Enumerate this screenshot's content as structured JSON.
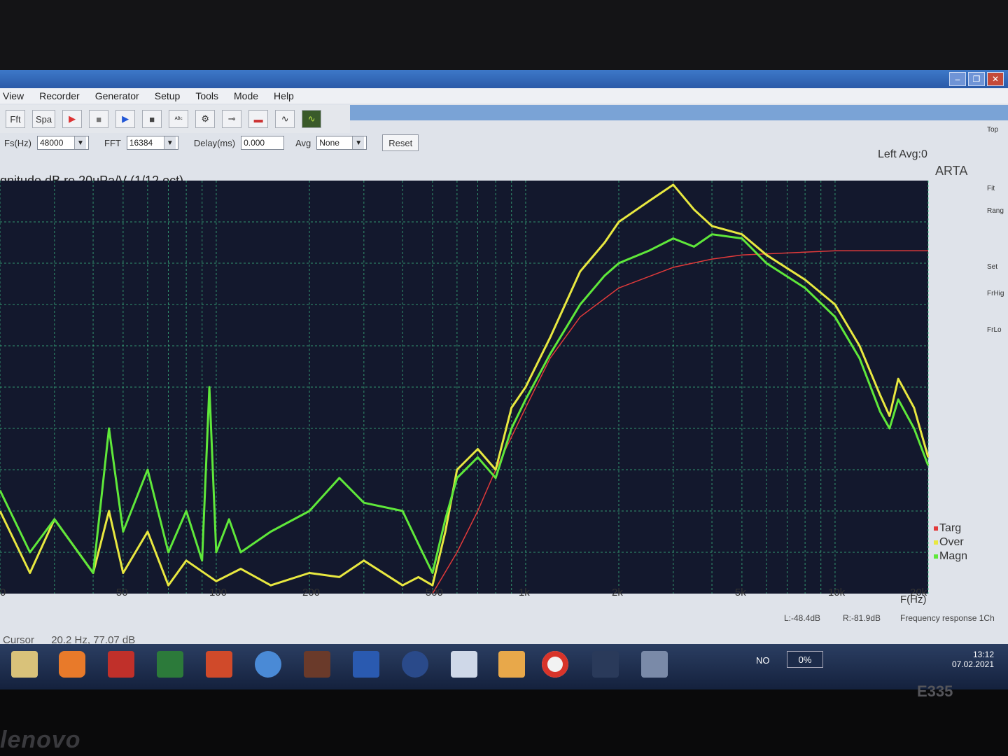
{
  "menu": [
    "View",
    "Recorder",
    "Generator",
    "Setup",
    "Tools",
    "Mode",
    "Help"
  ],
  "toolbar": {
    "fft_btn": "Fft",
    "spa_btn": "Spa",
    "fs_label": "Fs(Hz)",
    "fs_value": "48000",
    "fft_label": "FFT",
    "fft_value": "16384",
    "delay_label": "Delay(ms)",
    "delay_value": "0.000",
    "avg_label": "Avg",
    "avg_value": "None",
    "reset": "Reset"
  },
  "chart": {
    "title": "gnitude dB re 20uPa/V (1/12 oct)",
    "channel": "Left",
    "avg": "Avg:0",
    "arta": "ARTA",
    "xaxis_label": "F(Hz)",
    "status_left": "L:-48.4dB",
    "status_right": "R:-81.9dB",
    "status_mode": "Frequency response 1Ch",
    "cursor_label": "Cursor",
    "cursor_value": "20.2 Hz, 77.07 dB"
  },
  "chart_data": {
    "type": "line",
    "xscale": "log",
    "xlim": [
      20,
      20000
    ],
    "x_ticks": [
      20,
      50,
      100,
      200,
      500,
      1000,
      2000,
      5000,
      10000,
      20000
    ],
    "x_tick_labels": [
      "0",
      "50",
      "100",
      "200",
      "500",
      "1k",
      "2k",
      "5k",
      "10k",
      "20k"
    ],
    "xlabel": "F(Hz)",
    "ylabel": "gnitude dB re 20uPa/V (1/12 oct)",
    "grid": true,
    "legend": "right",
    "series": [
      {
        "name": "Targ",
        "color": "#e23a3a",
        "x": [
          500,
          600,
          700,
          800,
          1000,
          1200,
          1500,
          2000,
          3000,
          4000,
          5000,
          10000,
          20000
        ],
        "y": [
          0.0,
          0.1,
          0.2,
          0.3,
          0.45,
          0.57,
          0.67,
          0.74,
          0.79,
          0.81,
          0.82,
          0.83,
          0.83
        ]
      },
      {
        "name": "Over",
        "color": "#e8e840",
        "x": [
          20,
          25,
          30,
          40,
          45,
          50,
          60,
          70,
          80,
          100,
          120,
          150,
          200,
          250,
          300,
          400,
          450,
          500,
          550,
          600,
          700,
          800,
          900,
          1000,
          1200,
          1500,
          1800,
          2000,
          2500,
          3000,
          3500,
          4000,
          5000,
          6000,
          8000,
          10000,
          12000,
          14000,
          15000,
          16000,
          18000,
          20000
        ],
        "y": [
          0.2,
          0.05,
          0.18,
          0.05,
          0.2,
          0.05,
          0.15,
          0.02,
          0.08,
          0.03,
          0.06,
          0.02,
          0.05,
          0.04,
          0.08,
          0.02,
          0.04,
          0.02,
          0.15,
          0.3,
          0.35,
          0.3,
          0.45,
          0.5,
          0.62,
          0.78,
          0.85,
          0.9,
          0.95,
          0.99,
          0.93,
          0.89,
          0.87,
          0.82,
          0.76,
          0.7,
          0.6,
          0.48,
          0.43,
          0.52,
          0.45,
          0.33
        ]
      },
      {
        "name": "Magn",
        "color": "#5fe83a",
        "x": [
          20,
          25,
          30,
          40,
          45,
          50,
          60,
          70,
          80,
          90,
          95,
          100,
          110,
          120,
          150,
          200,
          250,
          300,
          400,
          450,
          500,
          550,
          600,
          700,
          800,
          900,
          1000,
          1200,
          1500,
          1800,
          2000,
          2500,
          3000,
          3500,
          4000,
          5000,
          6000,
          8000,
          10000,
          12000,
          14000,
          15000,
          16000,
          18000,
          20000
        ],
        "y": [
          0.25,
          0.1,
          0.18,
          0.05,
          0.4,
          0.15,
          0.3,
          0.1,
          0.2,
          0.08,
          0.5,
          0.1,
          0.18,
          0.1,
          0.15,
          0.2,
          0.28,
          0.22,
          0.2,
          0.12,
          0.05,
          0.18,
          0.28,
          0.33,
          0.28,
          0.4,
          0.47,
          0.58,
          0.7,
          0.77,
          0.8,
          0.83,
          0.86,
          0.84,
          0.87,
          0.86,
          0.8,
          0.74,
          0.67,
          0.57,
          0.44,
          0.4,
          0.47,
          0.4,
          0.31
        ]
      }
    ]
  },
  "taskbar": {
    "lang": "NO",
    "battery": "0%",
    "time": "13:12",
    "date": "07.02.2021"
  },
  "bezel": {
    "brand": "lenovo",
    "model": "E335"
  },
  "colors": {
    "plot_bg": "#13182d",
    "grid": "#3fc88a",
    "targ": "#e23a3a",
    "over": "#e8e840",
    "magn": "#5fe83a"
  }
}
